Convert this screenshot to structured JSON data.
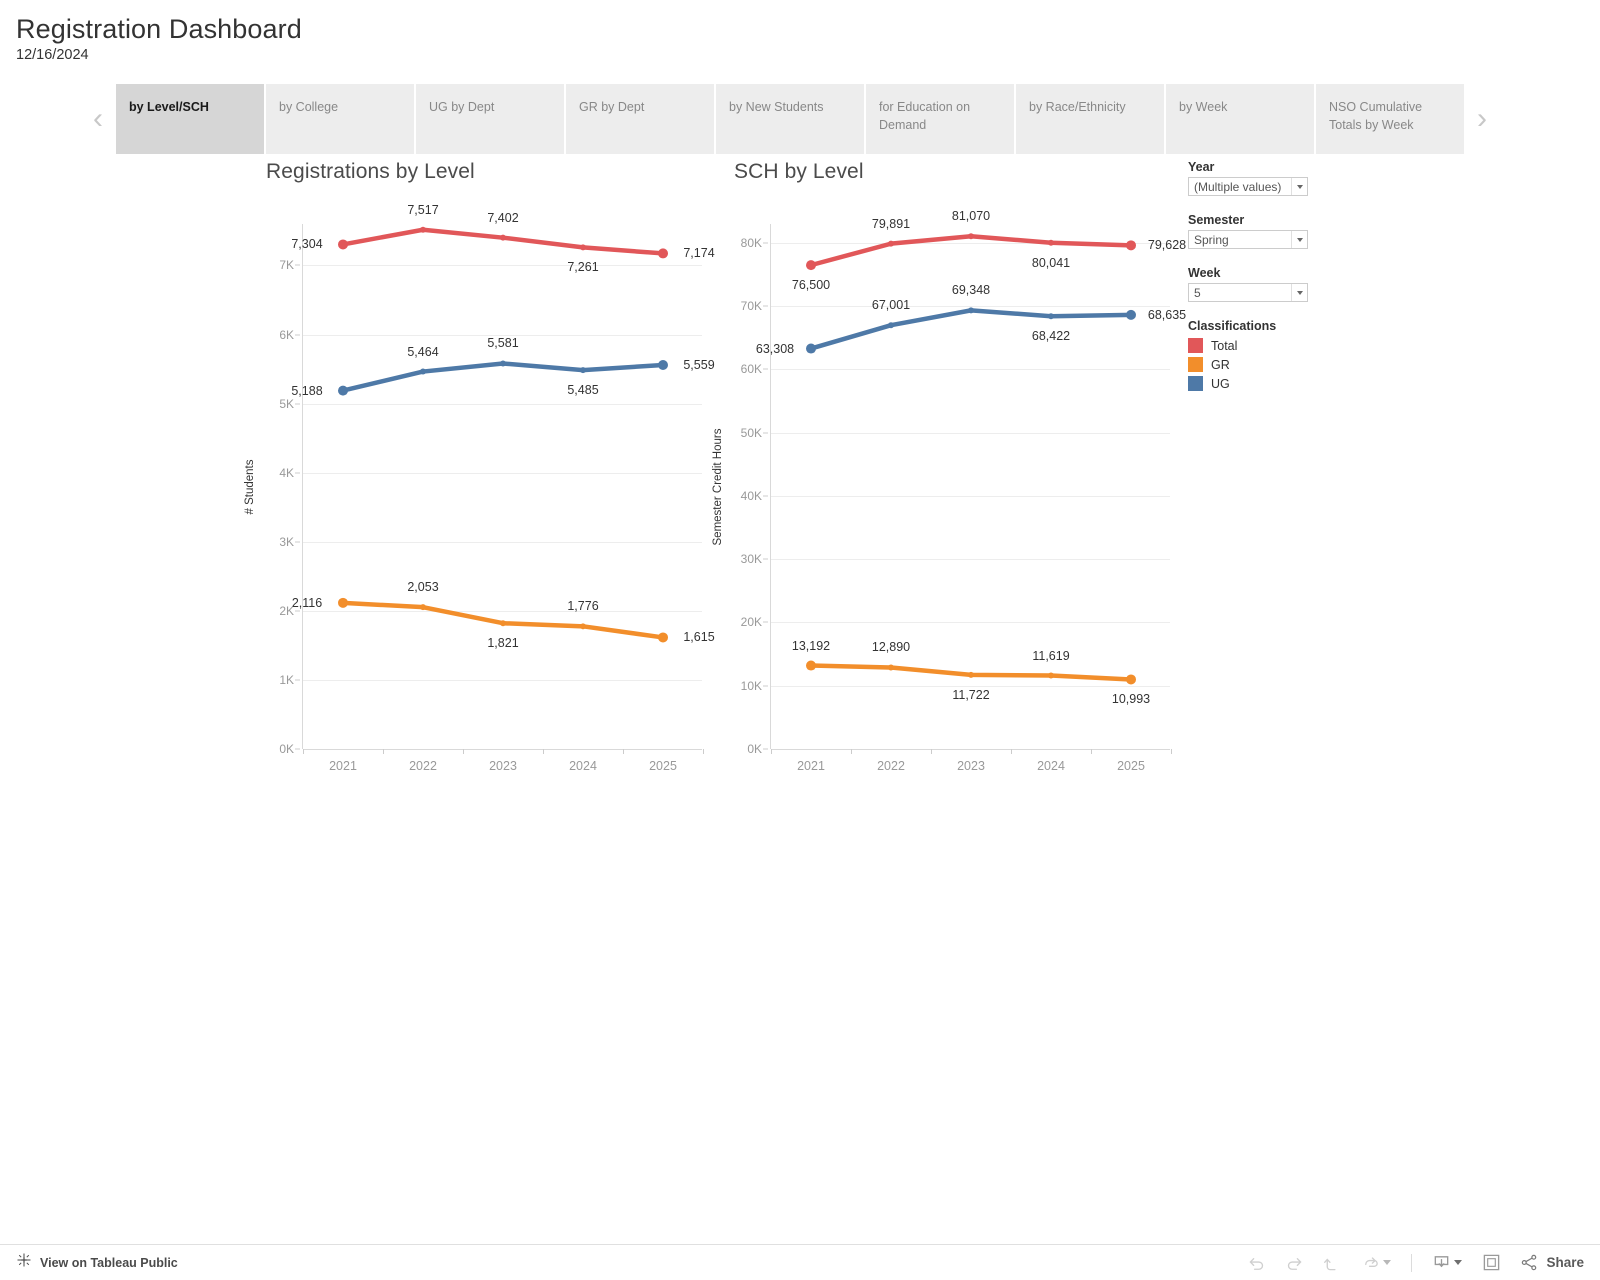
{
  "header": {
    "title": "Registration Dashboard",
    "date": "12/16/2024"
  },
  "tabs": {
    "prev_arrow": "‹",
    "next_arrow": "›",
    "items": [
      {
        "label": "by Level/SCH",
        "active": true
      },
      {
        "label": "by College",
        "active": false
      },
      {
        "label": "UG by Dept",
        "active": false
      },
      {
        "label": "GR by Dept",
        "active": false
      },
      {
        "label": "by New Students",
        "active": false
      },
      {
        "label": "for Education on Demand",
        "active": false
      },
      {
        "label": "by Race/Ethnicity",
        "active": false
      },
      {
        "label": "by Week",
        "active": false
      },
      {
        "label": "NSO Cumulative Totals by Week",
        "active": false
      }
    ]
  },
  "filters": {
    "year": {
      "label": "Year",
      "value": "(Multiple values)"
    },
    "semester": {
      "label": "Semester",
      "value": "Spring"
    },
    "week": {
      "label": "Week",
      "value": "5"
    }
  },
  "legend": {
    "title": "Classifications",
    "items": [
      {
        "name": "Total",
        "color": "#E15759"
      },
      {
        "name": "GR",
        "color": "#F28E2B"
      },
      {
        "name": "UG",
        "color": "#4E79A7"
      }
    ]
  },
  "toolbar": {
    "public_link": "View on Tableau Public",
    "share_label": "Share",
    "buttons": [
      "undo",
      "redo",
      "revert",
      "refresh",
      "download",
      "fullscreen",
      "share"
    ]
  },
  "chart_data": [
    {
      "type": "line",
      "title": "Registrations by Level",
      "xlabel": "",
      "ylabel": "# Students",
      "categories": [
        "2021",
        "2022",
        "2023",
        "2024",
        "2025"
      ],
      "ylim": [
        0,
        7600
      ],
      "yticks": [
        0,
        1000,
        2000,
        3000,
        4000,
        5000,
        6000,
        7000
      ],
      "ytick_labels": [
        "0K",
        "1K",
        "2K",
        "3K",
        "4K",
        "5K",
        "6K",
        "7K"
      ],
      "grid": true,
      "legend_position": "right",
      "series": [
        {
          "name": "Total",
          "color": "#E15759",
          "values": [
            7304,
            7517,
            7402,
            7261,
            7174
          ],
          "labels": [
            "7,304",
            "7,517",
            "7,402",
            "7,261",
            "7,174"
          ],
          "label_pos": [
            "left",
            "above",
            "above",
            "below",
            "right"
          ]
        },
        {
          "name": "UG",
          "color": "#4E79A7",
          "values": [
            5188,
            5464,
            5581,
            5485,
            5559
          ],
          "labels": [
            "5,188",
            "5,464",
            "5,581",
            "5,485",
            "5,559"
          ],
          "label_pos": [
            "left",
            "above",
            "above",
            "below",
            "right"
          ]
        },
        {
          "name": "GR",
          "color": "#F28E2B",
          "values": [
            2116,
            2053,
            1821,
            1776,
            1615
          ],
          "labels": [
            "2,116",
            "2,053",
            "1,821",
            "1,776",
            "1,615"
          ],
          "label_pos": [
            "left",
            "above",
            "below",
            "above",
            "right"
          ]
        }
      ]
    },
    {
      "type": "line",
      "title": "SCH by Level",
      "xlabel": "",
      "ylabel": "Semester Credit Hours",
      "categories": [
        "2021",
        "2022",
        "2023",
        "2024",
        "2025"
      ],
      "ylim": [
        0,
        83000
      ],
      "yticks": [
        0,
        10000,
        20000,
        30000,
        40000,
        50000,
        60000,
        70000,
        80000
      ],
      "ytick_labels": [
        "0K",
        "10K",
        "20K",
        "30K",
        "40K",
        "50K",
        "60K",
        "70K",
        "80K"
      ],
      "grid": true,
      "legend_position": "right",
      "series": [
        {
          "name": "Total",
          "color": "#E15759",
          "values": [
            76500,
            79891,
            81070,
            80041,
            79628
          ],
          "labels": [
            "76,500",
            "79,891",
            "81,070",
            "80,041",
            "79,628"
          ],
          "label_pos": [
            "below",
            "above",
            "above",
            "below",
            "right"
          ]
        },
        {
          "name": "UG",
          "color": "#4E79A7",
          "values": [
            63308,
            67001,
            69348,
            68422,
            68635
          ],
          "labels": [
            "63,308",
            "67,001",
            "69,348",
            "68,422",
            "68,635"
          ],
          "label_pos": [
            "left",
            "above",
            "above",
            "below",
            "right"
          ]
        },
        {
          "name": "GR",
          "color": "#F28E2B",
          "values": [
            13192,
            12890,
            11722,
            11619,
            10993
          ],
          "labels": [
            "13,192",
            "12,890",
            "11,722",
            "11,619",
            "10,993"
          ],
          "label_pos": [
            "above",
            "above",
            "below",
            "above",
            "below"
          ]
        }
      ]
    }
  ]
}
